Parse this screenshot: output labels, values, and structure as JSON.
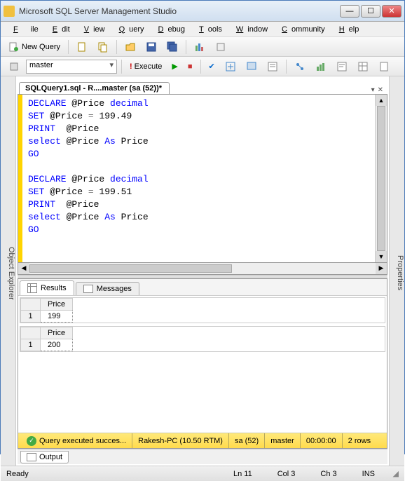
{
  "window": {
    "title": "Microsoft SQL Server Management Studio"
  },
  "menu": {
    "file": "File",
    "edit": "Edit",
    "view": "View",
    "query": "Query",
    "debug": "Debug",
    "tools": "Tools",
    "window": "Window",
    "community": "Community",
    "help": "Help"
  },
  "toolbar": {
    "new_query": "New Query"
  },
  "db_selector": {
    "value": "master"
  },
  "execute": {
    "label": "Execute"
  },
  "side": {
    "left": "Object Explorer",
    "right": "Properties"
  },
  "doc_tab": {
    "label": "SQLQuery1.sql - R....master (sa (52))*"
  },
  "editor_lines": [
    {
      "t": [
        {
          "c": "kw",
          "v": "DECLARE"
        },
        {
          "c": "",
          "v": " @Price "
        },
        {
          "c": "dt",
          "v": "decimal"
        }
      ]
    },
    {
      "t": [
        {
          "c": "kw",
          "v": "SET"
        },
        {
          "c": "",
          "v": " @Price "
        },
        {
          "c": "op",
          "v": "="
        },
        {
          "c": "",
          "v": " 199.49"
        }
      ]
    },
    {
      "t": [
        {
          "c": "kw",
          "v": "PRINT"
        },
        {
          "c": "",
          "v": "  @Price"
        }
      ]
    },
    {
      "t": [
        {
          "c": "kw",
          "v": "select"
        },
        {
          "c": "",
          "v": " @Price "
        },
        {
          "c": "kw",
          "v": "As"
        },
        {
          "c": "",
          "v": " Price"
        }
      ]
    },
    {
      "t": [
        {
          "c": "kw",
          "v": "GO"
        }
      ]
    },
    {
      "t": [
        {
          "c": "",
          "v": ""
        }
      ]
    },
    {
      "t": [
        {
          "c": "kw",
          "v": "DECLARE"
        },
        {
          "c": "",
          "v": " @Price "
        },
        {
          "c": "dt",
          "v": "decimal"
        }
      ]
    },
    {
      "t": [
        {
          "c": "kw",
          "v": "SET"
        },
        {
          "c": "",
          "v": " @Price "
        },
        {
          "c": "op",
          "v": "="
        },
        {
          "c": "",
          "v": " 199.51"
        }
      ]
    },
    {
      "t": [
        {
          "c": "kw",
          "v": "PRINT"
        },
        {
          "c": "",
          "v": "  @Price"
        }
      ]
    },
    {
      "t": [
        {
          "c": "kw",
          "v": "select"
        },
        {
          "c": "",
          "v": " @Price "
        },
        {
          "c": "kw",
          "v": "As"
        },
        {
          "c": "",
          "v": " Price"
        }
      ]
    },
    {
      "t": [
        {
          "c": "kw",
          "v": "GO"
        }
      ]
    }
  ],
  "results_tabs": {
    "results": "Results",
    "messages": "Messages"
  },
  "result_sets": [
    {
      "columns": [
        "Price"
      ],
      "rows": [
        [
          "199"
        ]
      ]
    },
    {
      "columns": [
        "Price"
      ],
      "rows": [
        [
          "200"
        ]
      ]
    }
  ],
  "query_status": {
    "msg": "Query executed succes...",
    "server": "Rakesh-PC (10.50 RTM)",
    "login": "sa (52)",
    "db": "master",
    "elapsed": "00:00:00",
    "rows": "2 rows"
  },
  "output_tab": {
    "label": "Output"
  },
  "statusbar": {
    "ready": "Ready",
    "ln": "Ln 11",
    "col": "Col 3",
    "ch": "Ch 3",
    "ins": "INS"
  }
}
